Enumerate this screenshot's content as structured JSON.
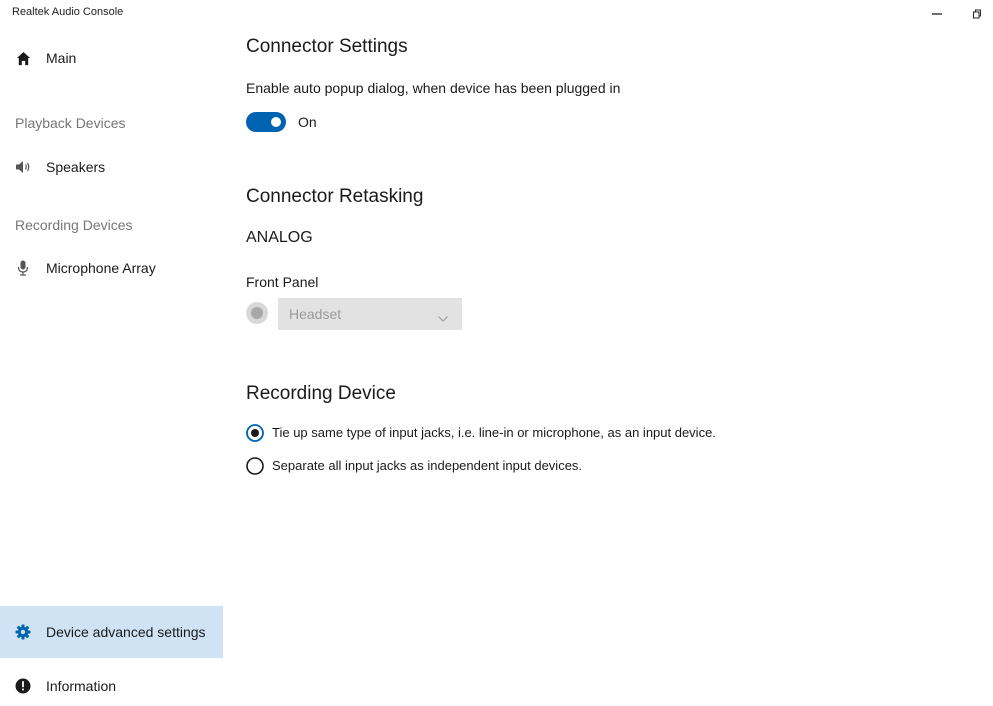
{
  "window": {
    "title": "Realtek Audio Console"
  },
  "sidebar": {
    "main_label": "Main",
    "playback_section": "Playback Devices",
    "speakers_label": "Speakers",
    "recording_section": "Recording Devices",
    "microphone_label": "Microphone Array",
    "advanced_label": "Device advanced settings",
    "information_label": "Information"
  },
  "main": {
    "connector_settings": {
      "heading": "Connector Settings",
      "description": "Enable auto popup dialog, when device has been plugged in",
      "toggle_state": "On"
    },
    "connector_retasking": {
      "heading": "Connector Retasking",
      "group": "ANALOG",
      "panel_label": "Front Panel",
      "selected_value": "Headset"
    },
    "recording_device": {
      "heading": "Recording Device",
      "options": [
        {
          "label": "Tie up same type of input jacks, i.e. line-in or microphone, as an input device.",
          "selected": true
        },
        {
          "label": "Separate all input jacks as independent input devices.",
          "selected": false
        }
      ]
    }
  },
  "colors": {
    "accent": "#0063b1",
    "active_nav_bg": "#cfe3f5"
  },
  "icons": {
    "home": "home-icon",
    "speakers": "speaker-icon",
    "microphone": "microphone-icon",
    "advanced": "gear-icon",
    "information": "info-icon",
    "minimize": "minimize-icon",
    "restore": "restore-icon",
    "dropdown": "chevron-down-icon"
  }
}
